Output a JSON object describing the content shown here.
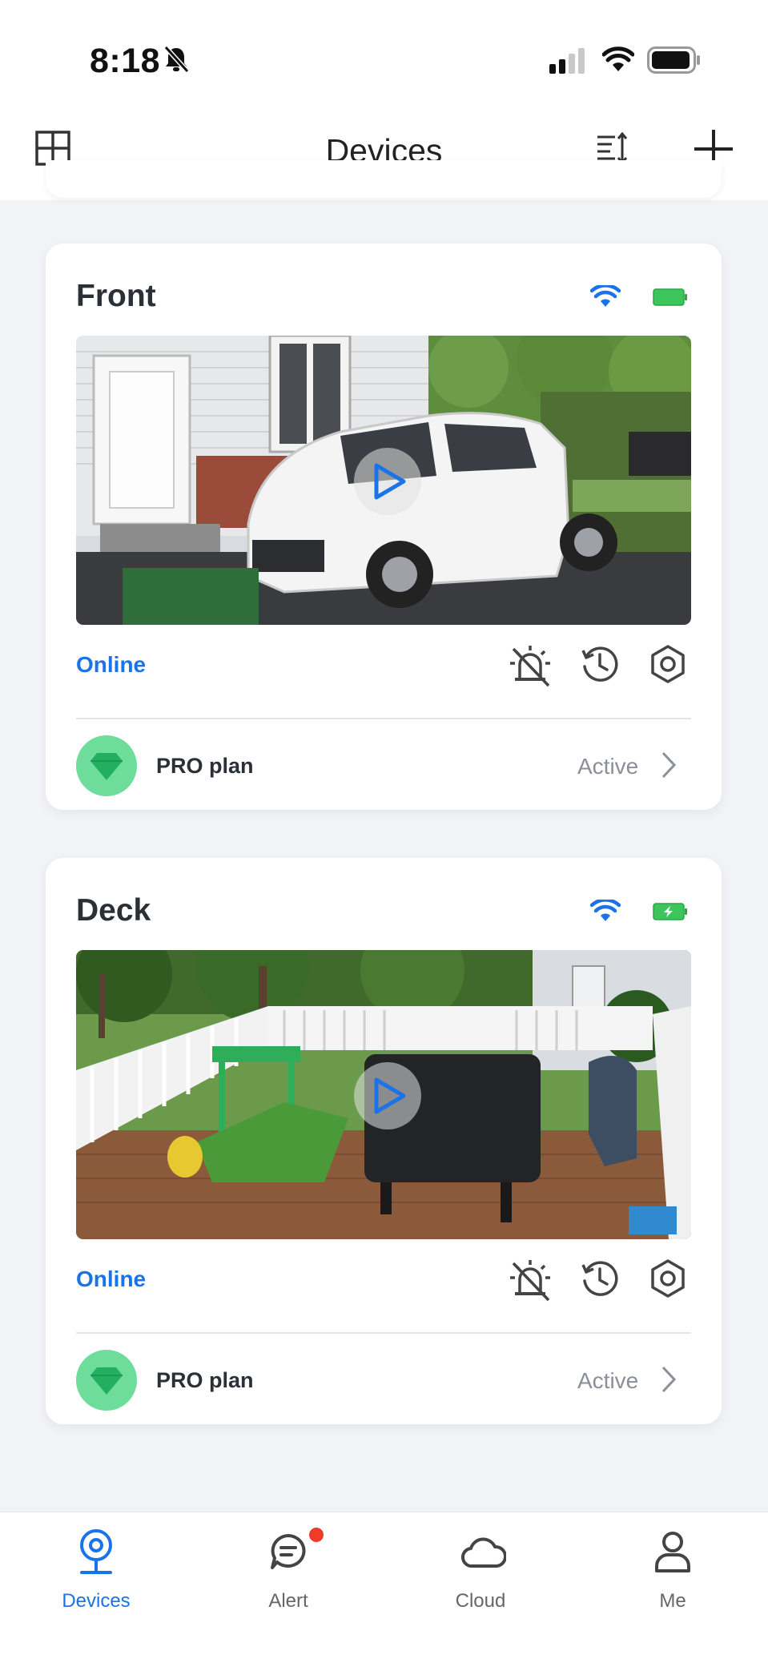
{
  "status": {
    "time": "8:18"
  },
  "header": {
    "title": "Devices"
  },
  "devices": [
    {
      "name": "Front",
      "status": "Online",
      "plan": "PRO plan",
      "plan_status": "Active"
    },
    {
      "name": "Deck",
      "status": "Online",
      "plan": "PRO plan",
      "plan_status": "Active"
    }
  ],
  "tabs": [
    {
      "label": "Devices",
      "icon": "camera-icon",
      "active": true
    },
    {
      "label": "Alert",
      "icon": "chat-icon",
      "active": false
    },
    {
      "label": "Cloud",
      "icon": "cloud-icon",
      "active": false
    },
    {
      "label": "Me",
      "icon": "person-icon",
      "active": false
    }
  ],
  "colors": {
    "accent": "#1a73e8",
    "plan_green": "#6edc9a",
    "battery_green": "#3cc55a",
    "alert_dot": "#f03a2a"
  }
}
